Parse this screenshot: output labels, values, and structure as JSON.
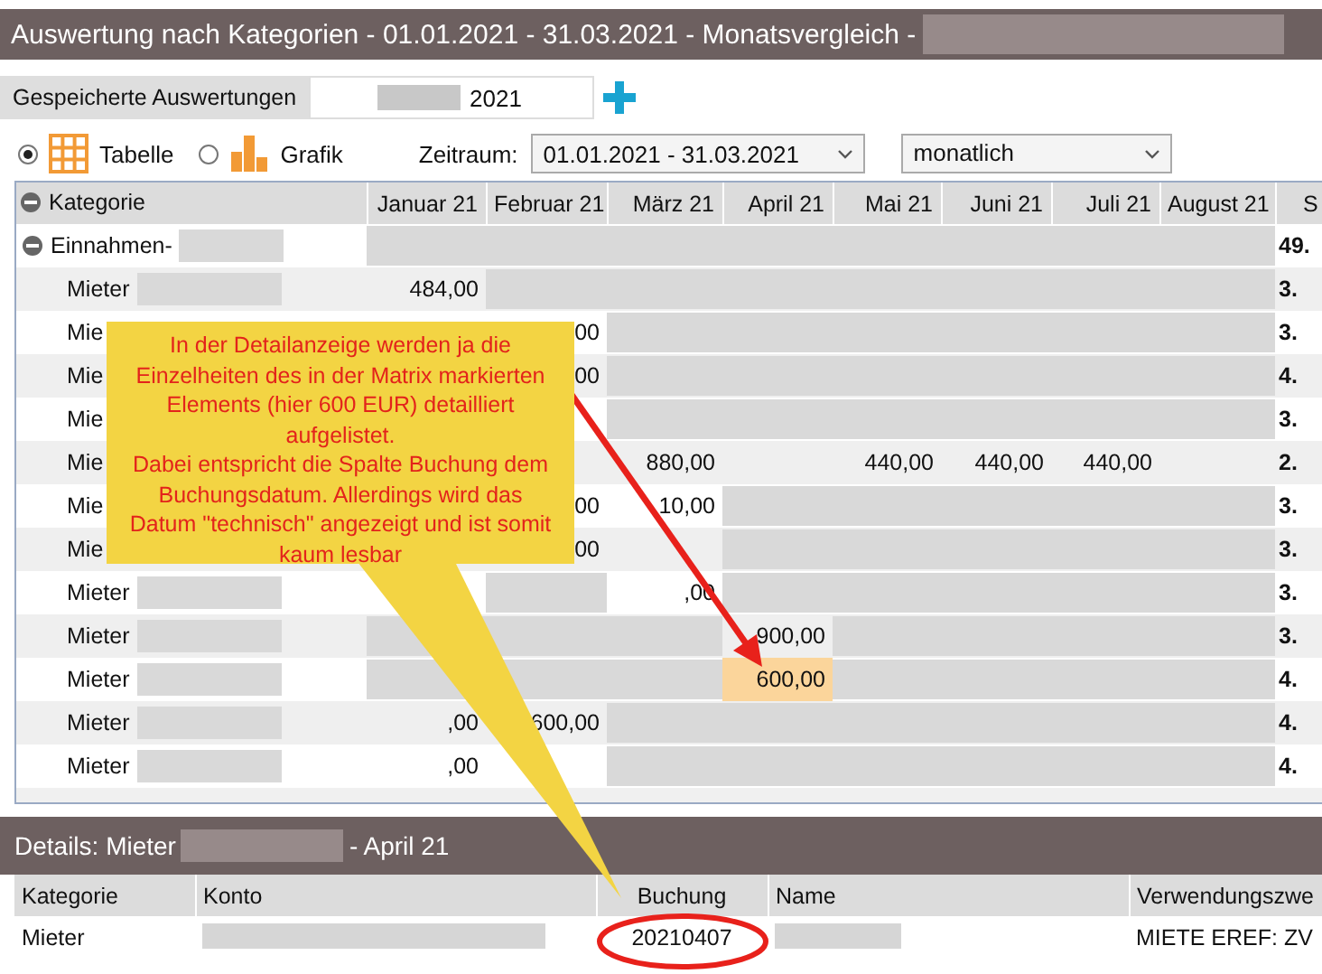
{
  "window": {
    "title": "Auswertung nach Kategorien - 01.01.2021 - 31.03.2021 - Monatsvergleich -"
  },
  "saved": {
    "label": "Gespeicherte Auswertungen",
    "value": "2021"
  },
  "view_options": [
    {
      "kind": "table",
      "label": "Tabelle",
      "selected": true
    },
    {
      "kind": "chart",
      "label": "Grafik",
      "selected": false
    }
  ],
  "period": {
    "label": "Zeitraum:",
    "value": "01.01.2021 - 31.03.2021"
  },
  "interval": {
    "value": "monatlich"
  },
  "table": {
    "label_header": "Kategorie",
    "columns": [
      "Januar 21",
      "Februar 21",
      "März 21",
      "April 21",
      "Mai 21",
      "Juni 21",
      "Juli 21",
      "August 21",
      "S"
    ],
    "rows": [
      {
        "kind": "group",
        "label": "Einnahmen-",
        "expanded": true,
        "cells": [
          {
            "blurred": true
          },
          {
            "blurred": true
          },
          {
            "blurred": true
          },
          {
            "blurred": true
          },
          {
            "blurred": true
          },
          {
            "blurred": true
          },
          {
            "blurred": true
          },
          {
            "blurred": true
          },
          {
            "text": "49.",
            "selected": false
          }
        ]
      },
      {
        "kind": "item",
        "label": "Mieter",
        "cells": [
          {
            "text": "484,00",
            "selected": false
          },
          {
            "blurred": true
          },
          {
            "blurred": true
          },
          {
            "blurred": true
          },
          {
            "blurred": true
          },
          {
            "blurred": true
          },
          {
            "blurred": true
          },
          {
            "blurred": true
          },
          {
            "text": "3.",
            "selected": false
          }
        ]
      },
      {
        "kind": "item",
        "label": "Mie",
        "cells": [
          null,
          {
            "text": "00",
            "selected": false
          },
          {
            "blurred": true
          },
          {
            "blurred": true
          },
          {
            "blurred": true
          },
          {
            "blurred": true
          },
          {
            "blurred": true
          },
          {
            "blurred": true
          },
          {
            "text": "3.",
            "selected": false
          }
        ]
      },
      {
        "kind": "item",
        "label": "Mie",
        "cells": [
          null,
          {
            "text": "00",
            "selected": false
          },
          {
            "blurred": true
          },
          {
            "blurred": true
          },
          {
            "blurred": true
          },
          {
            "blurred": true
          },
          {
            "blurred": true
          },
          {
            "blurred": true
          },
          {
            "text": "4.",
            "selected": false
          }
        ]
      },
      {
        "kind": "item",
        "label": "Mie",
        "cells": [
          null,
          null,
          {
            "blurred": true
          },
          {
            "blurred": true
          },
          {
            "blurred": true
          },
          {
            "blurred": true
          },
          {
            "blurred": true
          },
          {
            "blurred": true
          },
          {
            "text": "3.",
            "selected": false
          }
        ]
      },
      {
        "kind": "item",
        "label": "Mie",
        "cells": [
          null,
          null,
          {
            "text": "880,00",
            "selected": false
          },
          null,
          {
            "text": "440,00",
            "selected": false
          },
          {
            "text": "440,00",
            "selected": false
          },
          {
            "text": "440,00",
            "selected": false
          },
          null,
          {
            "text": "2.",
            "selected": false
          }
        ]
      },
      {
        "kind": "item",
        "label": "Mie",
        "cells": [
          null,
          {
            "text": "00",
            "selected": false
          },
          {
            "text": "10,00",
            "selected": false
          },
          {
            "blurred": true
          },
          {
            "blurred": true
          },
          {
            "blurred": true
          },
          {
            "blurred": true
          },
          {
            "blurred": true
          },
          {
            "text": "3.",
            "selected": false
          }
        ]
      },
      {
        "kind": "item",
        "label": "Mie",
        "cells": [
          null,
          {
            "text": "00",
            "selected": false
          },
          null,
          {
            "blurred": true
          },
          {
            "blurred": true
          },
          {
            "blurred": true
          },
          {
            "blurred": true
          },
          {
            "blurred": true
          },
          {
            "text": "3.",
            "selected": false
          }
        ]
      },
      {
        "kind": "item",
        "label": "Mieter",
        "cells": [
          null,
          {
            "blurred": true
          },
          {
            "text": ",00",
            "selected": false
          },
          {
            "blurred": true
          },
          {
            "blurred": true
          },
          {
            "blurred": true
          },
          {
            "blurred": true
          },
          {
            "blurred": true
          },
          {
            "text": "3.",
            "selected": false
          }
        ]
      },
      {
        "kind": "item",
        "label": "Mieter",
        "cells": [
          {
            "blurred": true
          },
          {
            "blurred": true
          },
          {
            "blurred": true
          },
          {
            "text": "900,00",
            "selected": false
          },
          {
            "blurred": true
          },
          {
            "blurred": true
          },
          {
            "blurred": true
          },
          {
            "blurred": true
          },
          {
            "text": "3.",
            "selected": false
          }
        ]
      },
      {
        "kind": "item",
        "label": "Mieter",
        "cells": [
          {
            "blurred": true
          },
          {
            "blurred": true
          },
          {
            "blurred": true
          },
          {
            "text": "600,00",
            "selected": true
          },
          {
            "blurred": true
          },
          {
            "blurred": true
          },
          {
            "blurred": true
          },
          {
            "blurred": true
          },
          {
            "text": "4.",
            "selected": false
          }
        ]
      },
      {
        "kind": "item",
        "label": "Mieter",
        "cells": [
          {
            "text": ",00",
            "selected": false
          },
          {
            "text": "600,00",
            "selected": false
          },
          {
            "blurred": true
          },
          {
            "blurred": true
          },
          {
            "blurred": true
          },
          {
            "blurred": true
          },
          {
            "blurred": true
          },
          {
            "blurred": true
          },
          {
            "text": "4.",
            "selected": false
          }
        ]
      },
      {
        "kind": "item",
        "label": "Mieter",
        "cells": [
          {
            "text": ",00",
            "selected": false
          },
          null,
          {
            "blurred": true
          },
          {
            "blurred": true
          },
          {
            "blurred": true
          },
          {
            "blurred": true
          },
          {
            "blurred": true
          },
          {
            "blurred": true
          },
          {
            "text": "4.",
            "selected": false
          }
        ]
      }
    ]
  },
  "details": {
    "title": "Details: Mieter",
    "title_suffix": "- April 21",
    "columns": [
      "Kategorie",
      "Konto",
      "Buchung",
      "Name",
      "Verwendungszwe"
    ],
    "rows": [
      {
        "cells": [
          {
            "text": "Mieter"
          },
          {
            "blurred": true
          },
          {
            "text": "20210407"
          },
          {
            "blurred": true
          },
          {
            "text": "MIETE EREF: ZV"
          }
        ]
      }
    ]
  },
  "annotation": {
    "text": "In der Detailanzeige werden ja die Einzelheiten des in der Matrix markierten Elements (hier 600 EUR) detailliert aufgelistet.\nDabei entspricht die Spalte Buchung dem Buchungsdatum. Allerdings wird das Datum \"technisch\" angezeigt und ist somit kaum lesbar"
  }
}
